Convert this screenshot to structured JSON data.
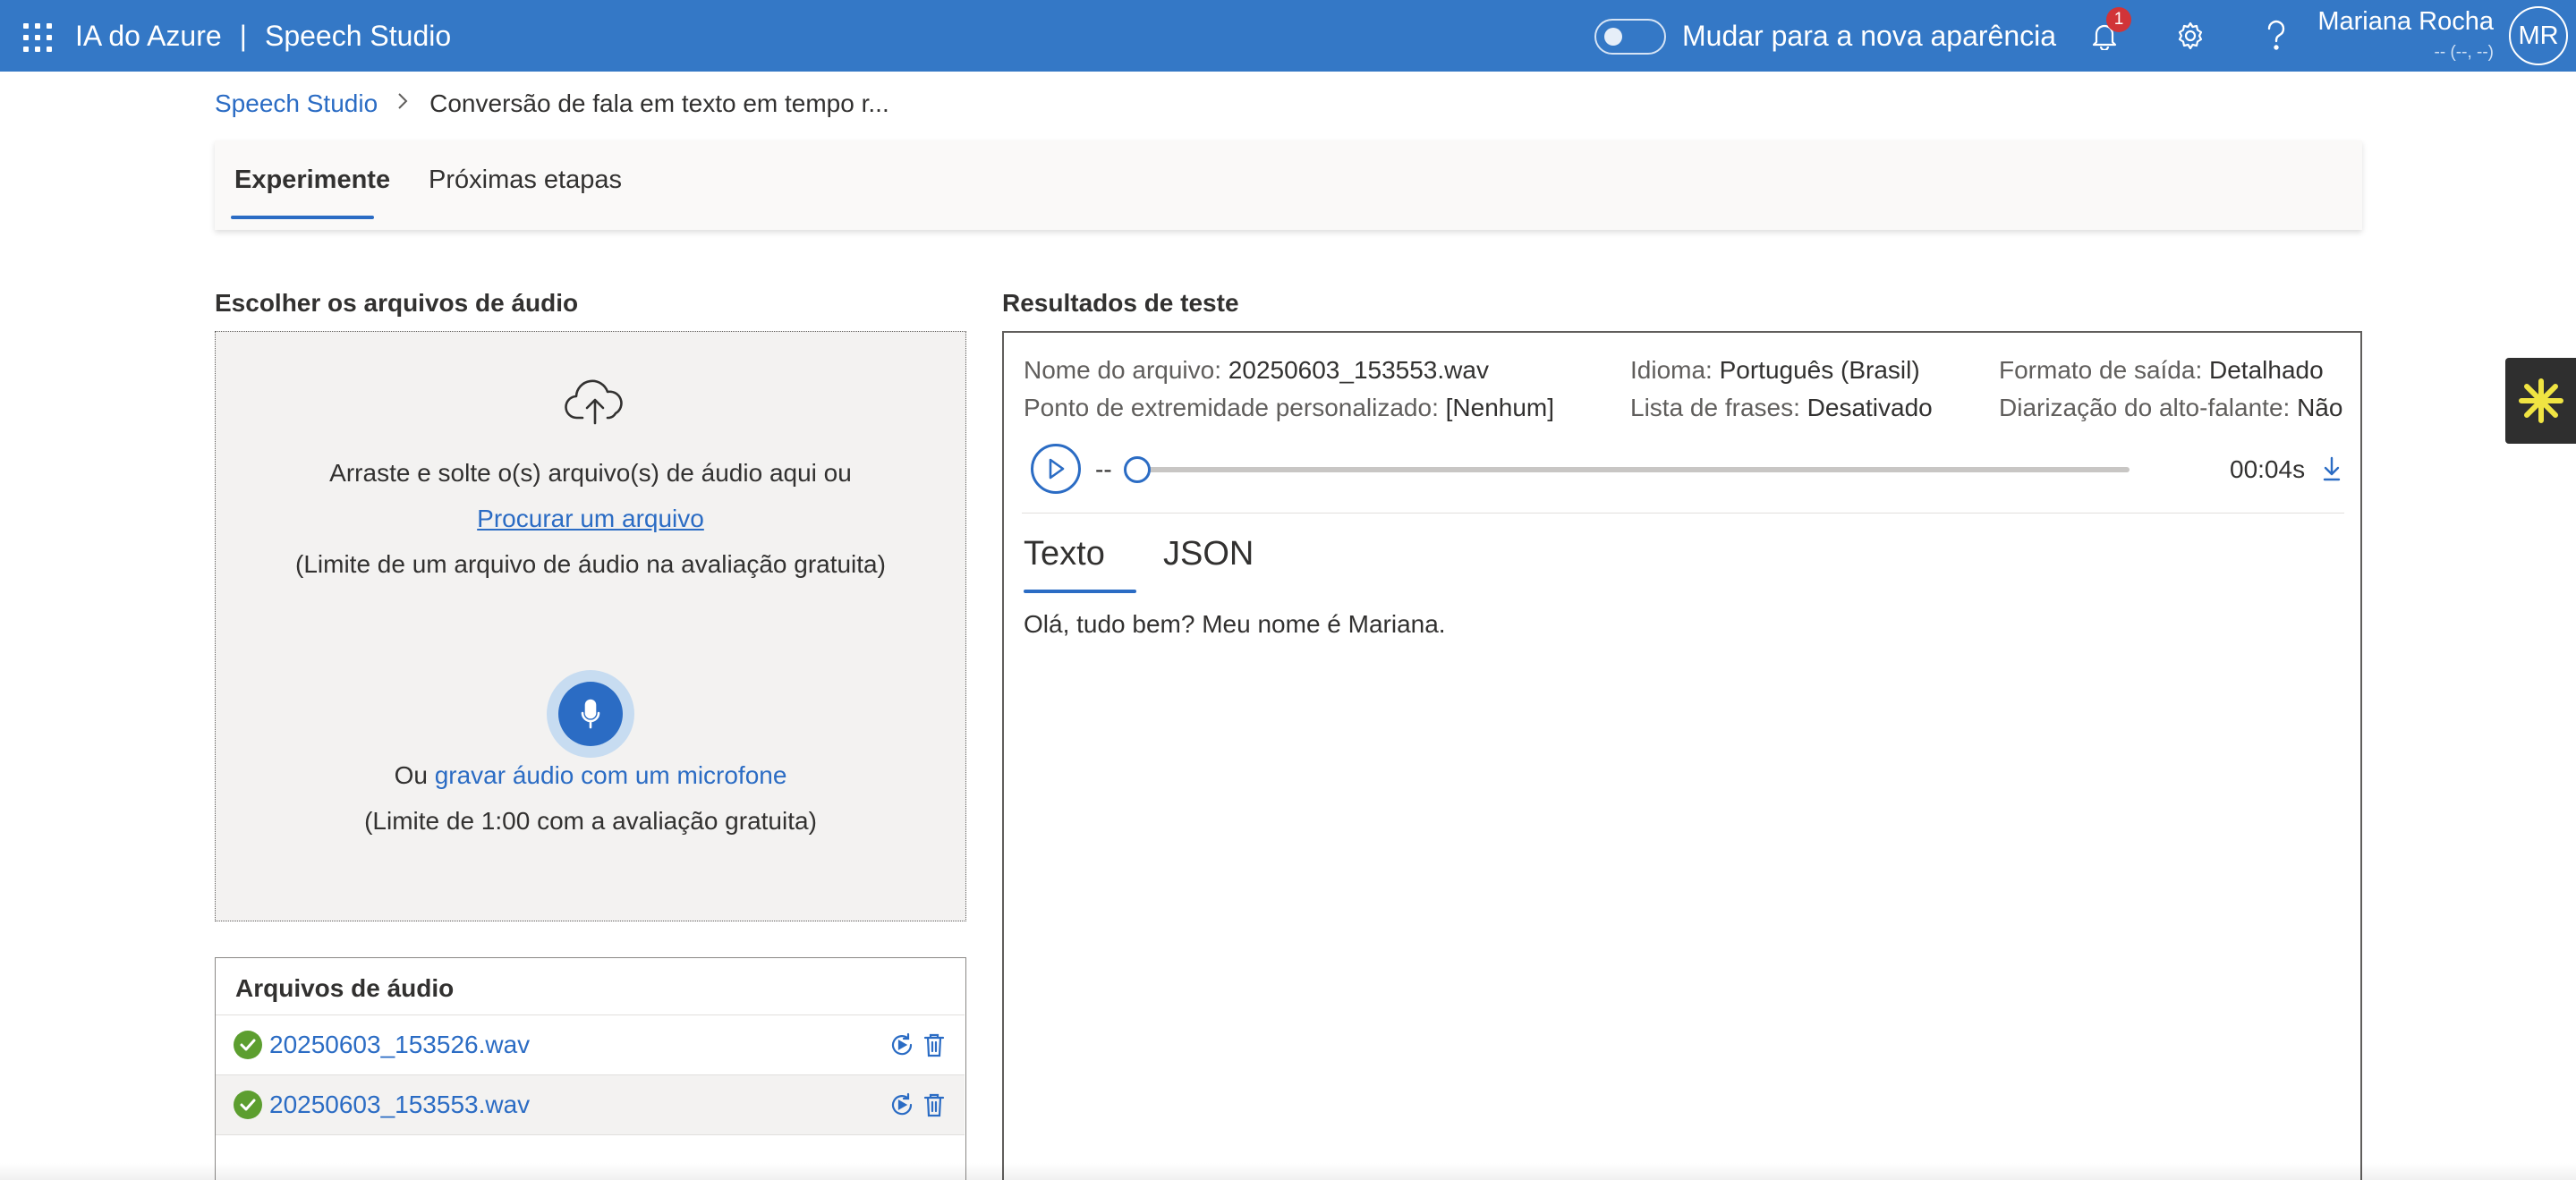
{
  "topbar": {
    "app_name": "IA do Azure",
    "separator": "|",
    "product": "Speech Studio",
    "toggle_label": "Mudar para a nova aparência",
    "notifications_count": "1",
    "user_name": "Mariana Rocha",
    "user_subtitle": "-- (--, --)",
    "avatar_initials": "MR",
    "accent_color": "#3478c6"
  },
  "breadcrumb": {
    "root": "Speech Studio",
    "current": "Conversão de fala em texto em tempo r..."
  },
  "tabs": [
    {
      "label": "Experimente",
      "active": true
    },
    {
      "label": "Próximas etapas",
      "active": false
    }
  ],
  "upload": {
    "title": "Escolher os arquivos de áudio",
    "drag_text": "Arraste e solte o(s) arquivo(s) de áudio aqui ou",
    "browse_link": "Procurar um arquivo",
    "file_limit": "(Limite de um arquivo de áudio na avaliação gratuita)",
    "or_text": "Ou",
    "record_link": "gravar áudio com um microfone",
    "time_limit": "(Limite de 1:00 com a avaliação gratuita)"
  },
  "audio_files": {
    "title": "Arquivos de áudio",
    "items": [
      {
        "name": "20250603_153526.wav",
        "status": "success"
      },
      {
        "name": "20250603_153553.wav",
        "status": "success"
      }
    ]
  },
  "results": {
    "title": "Resultados de teste",
    "file_name_label": "Nome do arquivo:",
    "file_name_value": "20250603_153553.wav",
    "endpoint_label": "Ponto de extremidade personalizado:",
    "endpoint_value": "[Nenhum]",
    "language_label": "Idioma:",
    "language_value": "Português (Brasil)",
    "phrase_list_label": "Lista de frases:",
    "phrase_list_value": "Desativado",
    "output_format_label": "Formato de saída:",
    "output_format_value": "Detalhado",
    "diarization_label": "Diarização do alto-falante:",
    "diarization_value": "Não",
    "player_position": "--",
    "player_duration": "00:04s",
    "player_progress": 0,
    "tabs": [
      {
        "label": "Texto",
        "active": true
      },
      {
        "label": "JSON",
        "active": false
      }
    ],
    "transcript": "Olá, tudo bem? Meu nome é Mariana."
  }
}
